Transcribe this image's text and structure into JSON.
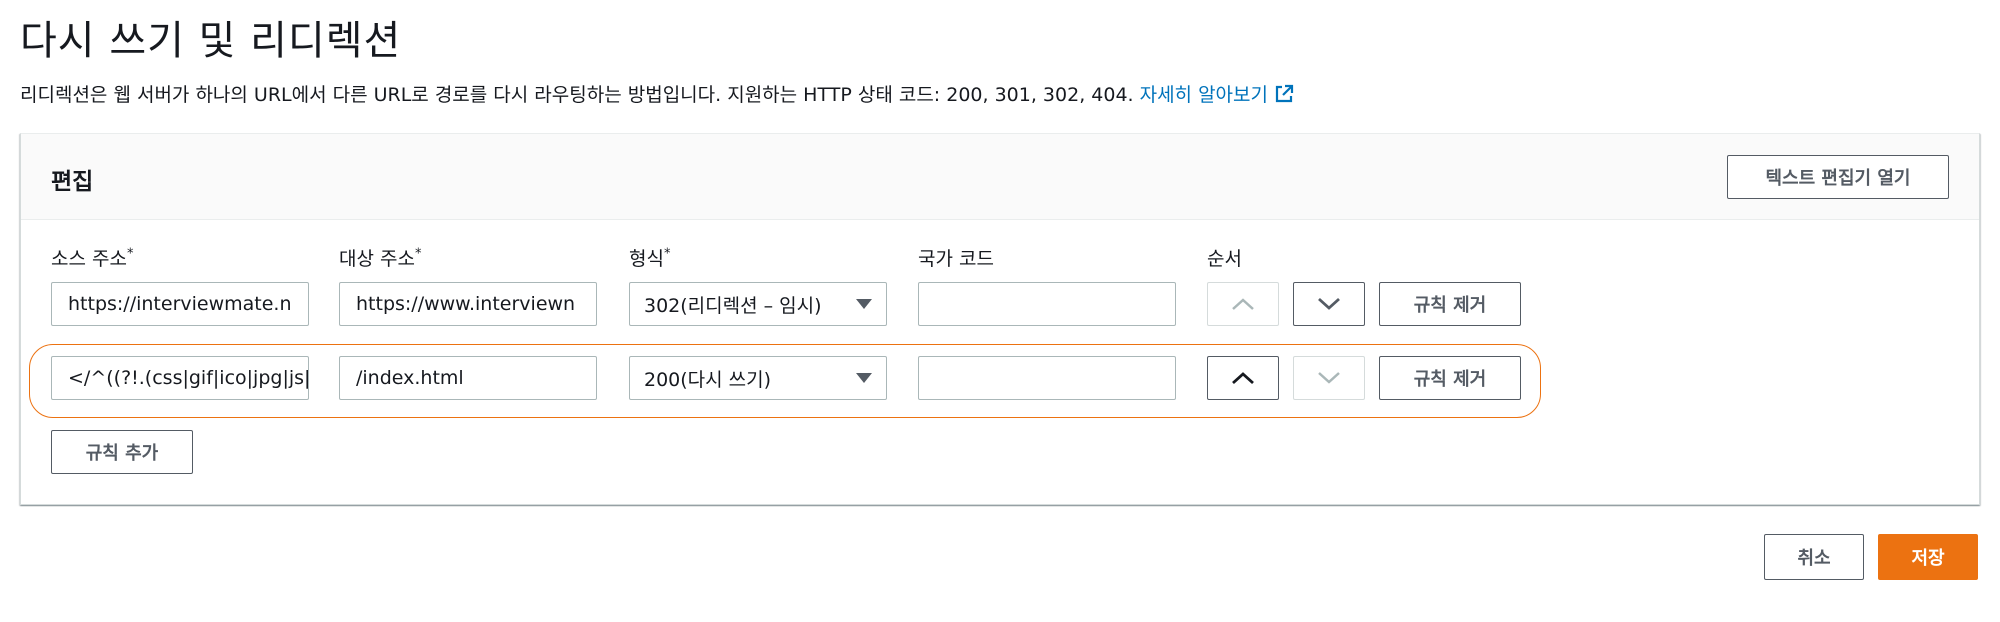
{
  "page": {
    "title": "다시 쓰기 및 리디렉션",
    "description": "리디렉션은 웹 서버가 하나의 URL에서 다른 URL로 경로를 다시 라우팅하는 방법입니다. 지원하는 HTTP 상태 코드: 200, 301, 302, 404.",
    "learn_more": "자세히 알아보기"
  },
  "panel": {
    "title": "편집",
    "open_text_editor": "텍스트 편집기 열기",
    "columns": {
      "source": "소스 주소",
      "target": "대상 주소",
      "type": "형식",
      "country": "국가 코드",
      "order": "순서",
      "required_mark": "*"
    },
    "rules": [
      {
        "source": "https://interviewmate.n",
        "target": "https://www.interviewn",
        "type": "302(리디렉션 – 임시)",
        "country": "",
        "move_up_enabled": false,
        "move_down_enabled": true,
        "remove_label": "규칙 제거"
      },
      {
        "source": "</^((?!.(css|gif|ico|jpg|js|",
        "target": "/index.html",
        "type": "200(다시 쓰기)",
        "country": "",
        "move_up_enabled": true,
        "move_down_enabled": false,
        "remove_label": "규칙 제거",
        "highlighted": true
      }
    ],
    "add_rule": "규칙 추가"
  },
  "footer": {
    "cancel": "취소",
    "save": "저장"
  },
  "colors": {
    "accent": "#ec7211",
    "link": "#0073bb",
    "highlight_outline": "#ec7211"
  },
  "icons": {
    "external_link": "external-link-icon",
    "move_up": "chevron-up-icon",
    "move_down": "chevron-down-icon",
    "dropdown": "caret-down-icon"
  }
}
